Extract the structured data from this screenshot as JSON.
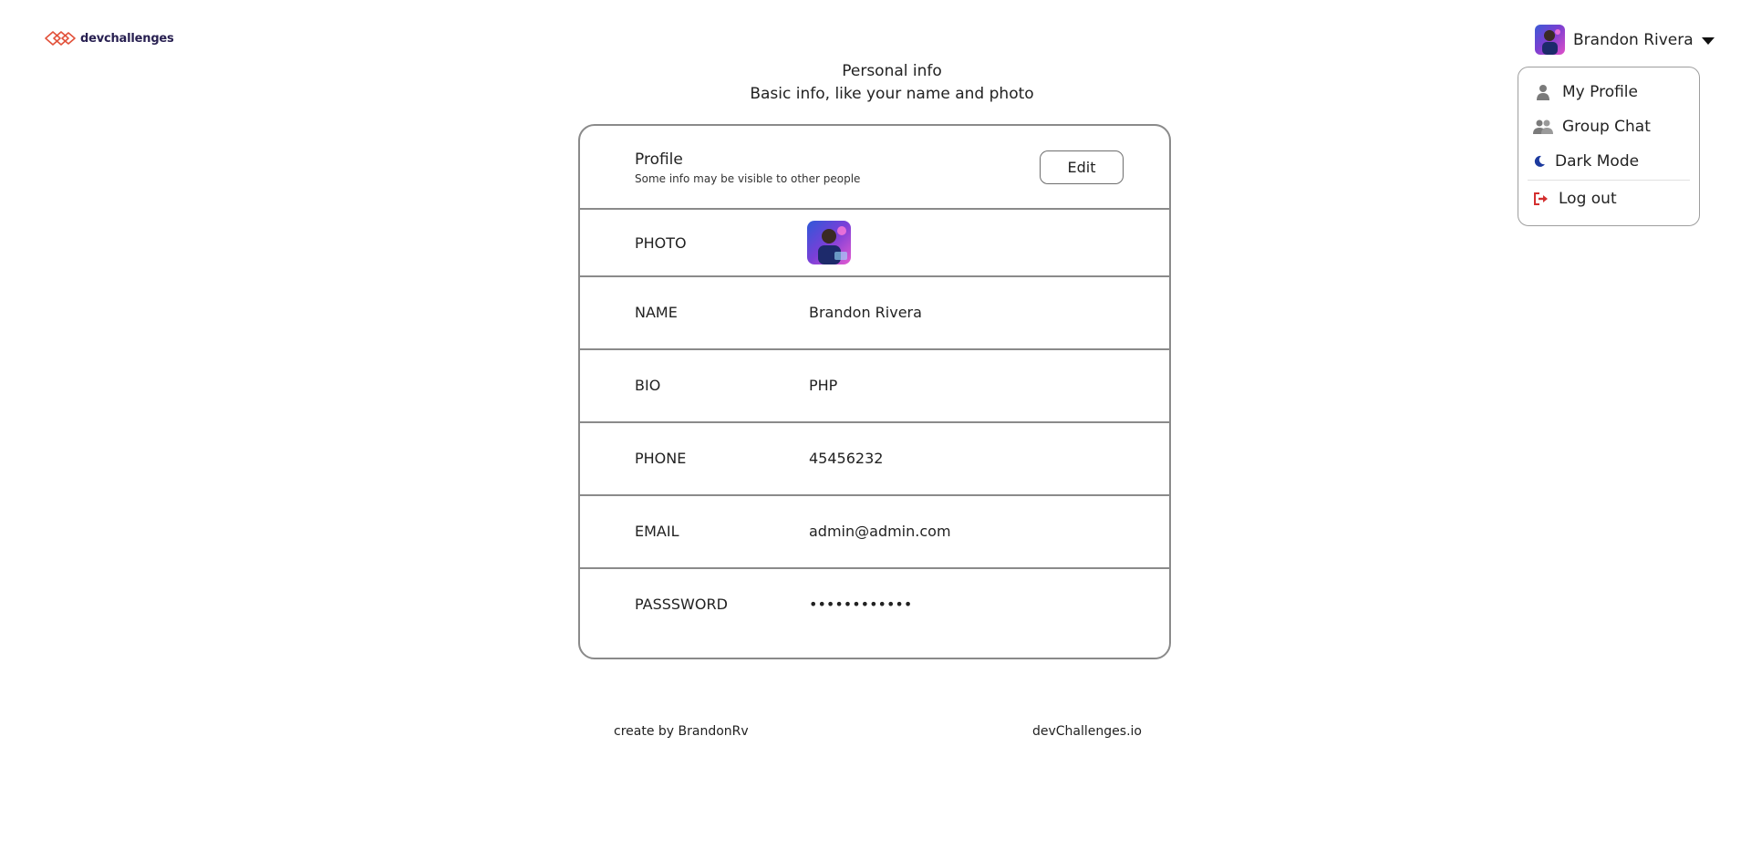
{
  "brand": {
    "name": "devchallenges",
    "accent": "#e2513a"
  },
  "user": {
    "name": "Brandon Rivera"
  },
  "menu": {
    "items": [
      {
        "label": "My Profile",
        "icon": "person-icon"
      },
      {
        "label": "Group Chat",
        "icon": "group-icon"
      },
      {
        "label": "Dark Mode",
        "icon": "moon-icon"
      },
      {
        "label": "Log out",
        "icon": "logout-icon",
        "color": "#d32f2f"
      }
    ]
  },
  "header": {
    "title": "Personal info",
    "subtitle": "Basic info, like your name and photo"
  },
  "card": {
    "title": "Profile",
    "subtitle": "Some info may be visible to other people",
    "edit_label": "Edit",
    "rows": [
      {
        "key": "PHOTO",
        "value": ""
      },
      {
        "key": "NAME",
        "value": "Brandon Rivera"
      },
      {
        "key": "BIO",
        "value": "PHP"
      },
      {
        "key": "PHONE",
        "value": "45456232"
      },
      {
        "key": "EMAIL",
        "value": "admin@admin.com"
      },
      {
        "key": "PASSSWORD",
        "value": "••••••••••••"
      }
    ]
  },
  "footer": {
    "left": "create by BrandonRv",
    "right": "devChallenges.io"
  }
}
